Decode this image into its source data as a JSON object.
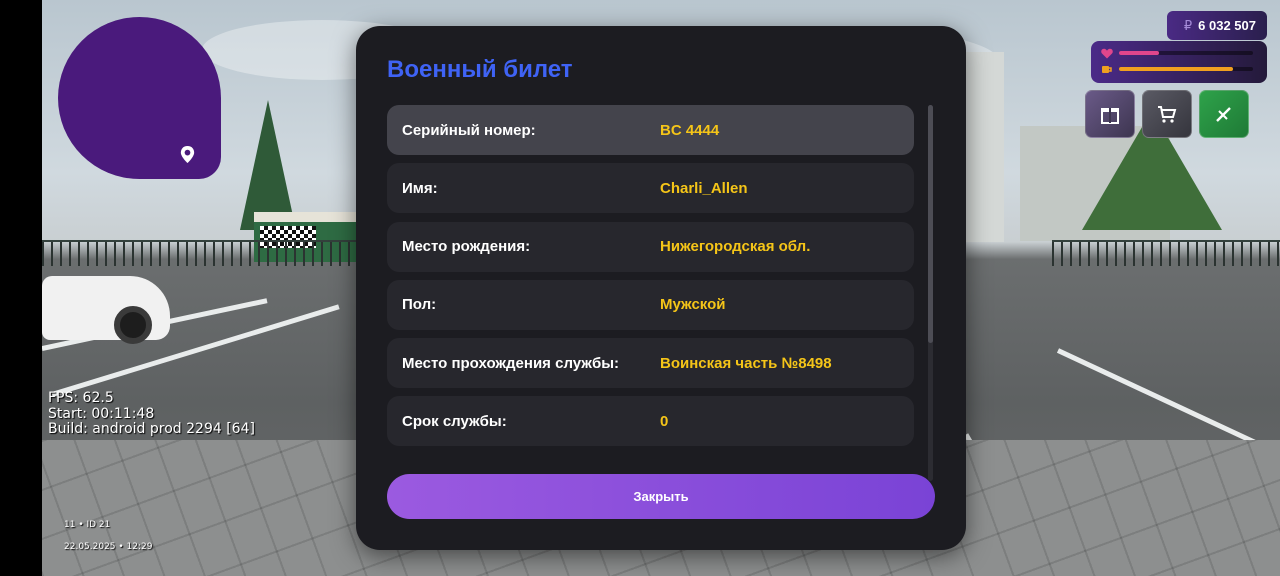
{
  "modal": {
    "title": "Военный билет",
    "rows": [
      {
        "label": "Серийный номер:",
        "value": "BC 4444"
      },
      {
        "label": "Имя:",
        "value": "Charli_Allen"
      },
      {
        "label": "Место рождения:",
        "value": "Нижегородская обл."
      },
      {
        "label": "Пол:",
        "value": "Мужской"
      },
      {
        "label": "Место прохождения службы:",
        "value": "Воинская часть №8498"
      },
      {
        "label": "Срок службы:",
        "value": "0"
      }
    ],
    "close_label": "Закрыть"
  },
  "hud": {
    "currency_symbol": "₽",
    "money": "6 032 507",
    "health_fraction": 0.3,
    "hunger_fraction": 0.85,
    "buttons": [
      "gift-icon",
      "cart-icon",
      "tools-icon"
    ]
  },
  "debug": {
    "fps": "FPS: 62.5",
    "start": "Start: 00:11:48",
    "build": "Build: android prod 2294 [64]"
  },
  "meta": {
    "id": "11 • ID 21",
    "datetime": "22.05.2025 • 12:29"
  },
  "colors": {
    "title": "#3f63f5",
    "value": "#f5c518",
    "close_button": "#8a4fdb",
    "minimap": "#4a1a7c",
    "health": "#e0468c",
    "hunger": "#f0a020"
  }
}
